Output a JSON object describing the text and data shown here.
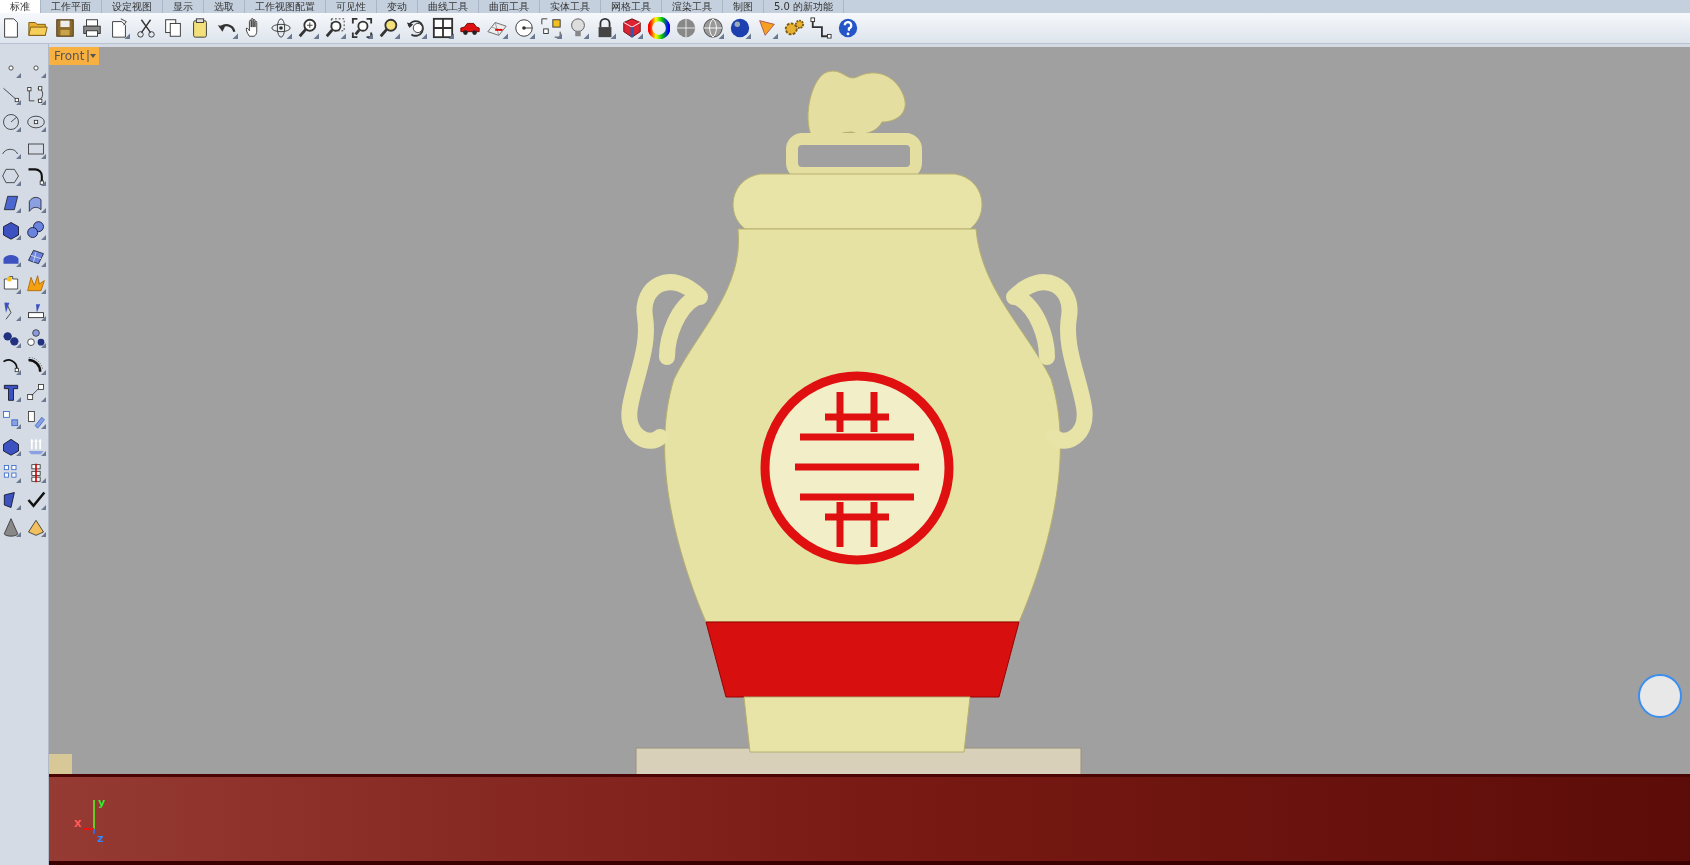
{
  "tabs": [
    {
      "label": "标准",
      "selected": true
    },
    {
      "label": "工作平面",
      "selected": false
    },
    {
      "label": "设定视图",
      "selected": false
    },
    {
      "label": "显示",
      "selected": false
    },
    {
      "label": "选取",
      "selected": false
    },
    {
      "label": "工作视图配置",
      "selected": false
    },
    {
      "label": "可见性",
      "selected": false
    },
    {
      "label": "变动",
      "selected": false
    },
    {
      "label": "曲线工具",
      "selected": false
    },
    {
      "label": "曲面工具",
      "selected": false
    },
    {
      "label": "实体工具",
      "selected": false
    },
    {
      "label": "网格工具",
      "selected": false
    },
    {
      "label": "渲染工具",
      "selected": false
    },
    {
      "label": "制图",
      "selected": false
    },
    {
      "label": "5.0 的新功能",
      "selected": false
    }
  ],
  "viewport": {
    "title": "Front",
    "axes": {
      "x": "x",
      "y": "y",
      "z": "z"
    }
  }
}
